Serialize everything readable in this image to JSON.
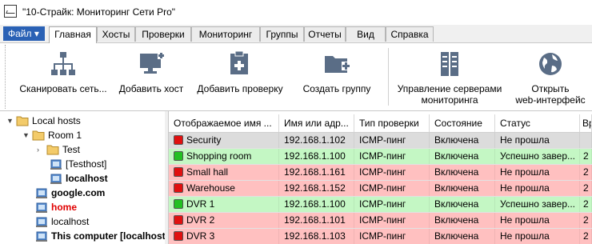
{
  "window": {
    "title": "\"10-Страйк: Мониторинг Сети Pro\""
  },
  "menu": {
    "file_label": "Файл ▾",
    "tabs": [
      {
        "label": "Главная",
        "active": true
      },
      {
        "label": "Хосты"
      },
      {
        "label": "Проверки"
      },
      {
        "label": "Мониторинг"
      },
      {
        "label": "Группы"
      },
      {
        "label": "Отчеты"
      },
      {
        "label": "Вид"
      },
      {
        "label": "Справка"
      }
    ]
  },
  "toolbar": {
    "scan": "Сканировать сеть...",
    "add_host": "Добавить хост",
    "add_check": "Добавить проверку",
    "create_group": "Создать группу",
    "manage_servers_1": "Управление серверами",
    "manage_servers_2": "мониторинга",
    "open_web_1": "Открыть",
    "open_web_2": "web-интерфейс"
  },
  "tree": [
    {
      "label": "Local hosts",
      "icon": "folder-icon",
      "expand": "▼"
    },
    {
      "label": "Room 1",
      "icon": "folder-icon",
      "expand": "▼"
    },
    {
      "label": "Test",
      "icon": "folder-icon",
      "expand": "›"
    },
    {
      "label": "[Testhost]",
      "icon": "computer-icon"
    },
    {
      "label": "localhost",
      "icon": "computer-icon",
      "style": "bold"
    },
    {
      "label": "google.com",
      "icon": "computer-icon",
      "style": "bold"
    },
    {
      "label": "home",
      "icon": "computer-icon",
      "style": "red"
    },
    {
      "label": "localhost",
      "icon": "computer-icon"
    },
    {
      "label": "This computer [localhost]",
      "icon": "computer-icon",
      "style": "bold"
    }
  ],
  "grid": {
    "columns": [
      "Отображаемое имя ...",
      "Имя или адр...",
      "Тип проверки",
      "Состояние",
      "Статус",
      "Вр"
    ],
    "rows": [
      {
        "name": "Security",
        "addr": "192.168.1.102",
        "type": "ICMP-пинг",
        "state": "Включена",
        "status": "Не прошла",
        "extra": "",
        "result": "fail",
        "selected": true
      },
      {
        "name": "Shopping room",
        "addr": "192.168.1.100",
        "type": "ICMP-пинг",
        "state": "Включена",
        "status": "Успешно завер...",
        "extra": "2",
        "result": "ok"
      },
      {
        "name": "Small hall",
        "addr": "192.168.1.161",
        "type": "ICMP-пинг",
        "state": "Включена",
        "status": "Не прошла",
        "extra": "2",
        "result": "fail"
      },
      {
        "name": "Warehouse",
        "addr": "192.168.1.152",
        "type": "ICMP-пинг",
        "state": "Включена",
        "status": "Не прошла",
        "extra": "2",
        "result": "fail"
      },
      {
        "name": "DVR 1",
        "addr": "192.168.1.100",
        "type": "ICMP-пинг",
        "state": "Включена",
        "status": "Успешно завер...",
        "extra": "2",
        "result": "ok"
      },
      {
        "name": "DVR 2",
        "addr": "192.168.1.101",
        "type": "ICMP-пинг",
        "state": "Включена",
        "status": "Не прошла",
        "extra": "2",
        "result": "fail"
      },
      {
        "name": "DVR 3",
        "addr": "192.168.1.103",
        "type": "ICMP-пинг",
        "state": "Включена",
        "status": "Не прошла",
        "extra": "2",
        "result": "fail"
      }
    ]
  },
  "colors": {
    "row_fail": "#ffc0c0",
    "row_ok": "#c4f7c4",
    "row_selected": "#dcdcdc",
    "indicator_fail": "#e01010",
    "indicator_ok": "#22c022",
    "file_button": "#2a61b5"
  }
}
